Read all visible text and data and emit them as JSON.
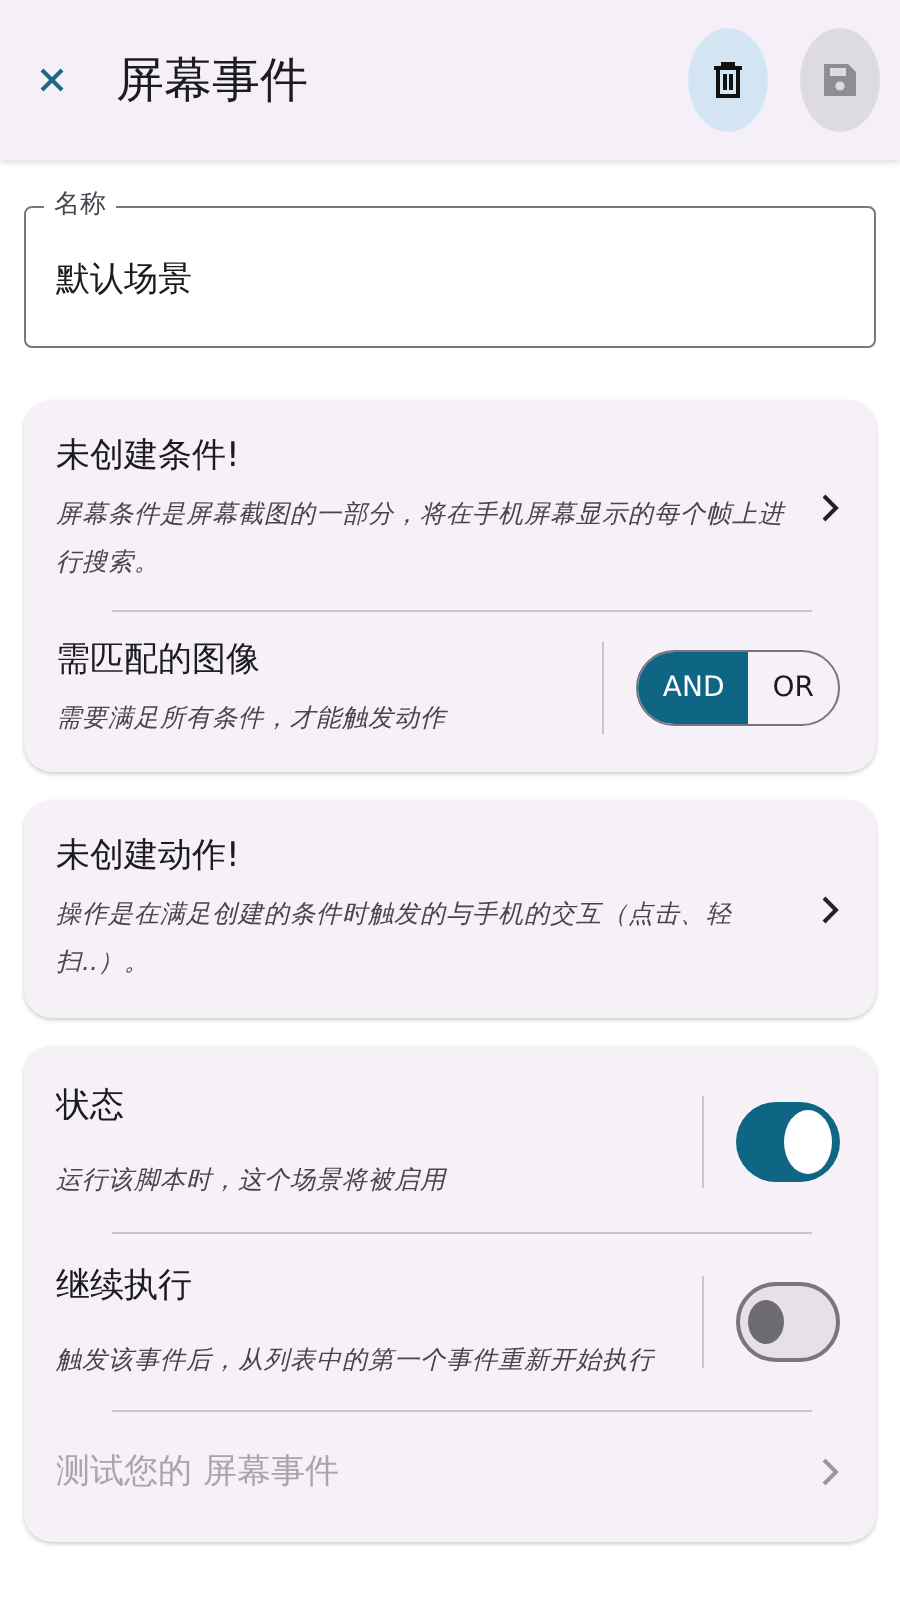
{
  "app_bar": {
    "title": "屏幕事件",
    "actions": [
      {
        "kind": "delete",
        "disabled": false
      },
      {
        "kind": "save",
        "disabled": true
      }
    ]
  },
  "name_field": {
    "label": "名称",
    "value": "默认场景"
  },
  "conditions_card": {
    "title": "未创建条件!",
    "description": "屏幕条件是屏幕截图的一部分，将在手机屏幕显示的每个帧上进行搜索。",
    "match": {
      "title": "需匹配的图像",
      "description": "需要满足所有条件，才能触发动作",
      "options": [
        {
          "label": "AND",
          "selected": true
        },
        {
          "label": "OR",
          "selected": false
        }
      ]
    }
  },
  "actions_card": {
    "title": "未创建动作!",
    "description": "操作是在满足创建的条件时触发的与手机的交互（点击、轻扫..）。"
  },
  "settings_card": {
    "toggles": [
      {
        "title": "状态",
        "description": "运行该脚本时，这个场景将被启用",
        "on": true
      },
      {
        "title": "继续执行",
        "description": "触发该事件后，从列表中的第一个事件重新开始执行",
        "on": false
      }
    ],
    "test": {
      "label": "测试您的 屏幕事件",
      "disabled": true
    }
  }
}
